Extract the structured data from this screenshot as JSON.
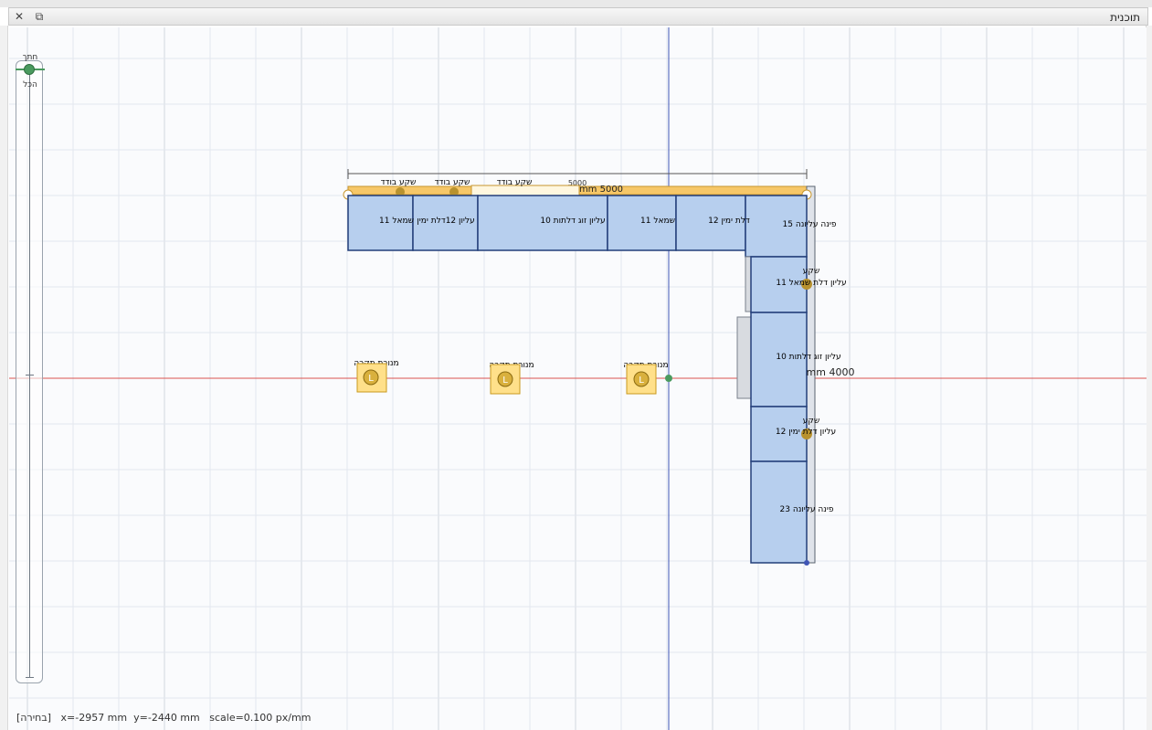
{
  "window": {
    "title": "תוכנית",
    "close_glyph": "✕",
    "restore_glyph": "⧉"
  },
  "zoom": {
    "top_label": "חתך",
    "bottom_label": "הכל"
  },
  "dimensions": {
    "overall_width_small": "5000",
    "overall_width_large": "mm 5000",
    "overall_depth_large": "mm 4000"
  },
  "labels_top": {
    "sink1": "שקע בודד",
    "sink2": "שקע בודד",
    "sink3": "שקע בודד"
  },
  "cabinets_top": [
    {
      "label": "שמאל 11",
      "name": "cabinet-left-11"
    },
    {
      "label": "עליון 12דלת ימין",
      "name": "cabinet-top-12-right"
    },
    {
      "label": "עליון זוג דלתות 10",
      "name": "cabinet-double-10"
    },
    {
      "label": "שמאל 11",
      "name": "cabinet-left-11-b"
    },
    {
      "label": "12 דלת ימין",
      "name": "cabinet-right-12"
    },
    {
      "label": "פינה עליונה 15",
      "name": "cabinet-corner-15"
    }
  ],
  "cabinets_right": [
    {
      "label": "עליון דלת שמאל 11",
      "name": "cabinet-upper-left-11"
    },
    {
      "label": "עליון זוג דלתות 10",
      "name": "cabinet-upper-double-10"
    },
    {
      "label": "עליון דלת ימין 12",
      "name": "cabinet-upper-right-12"
    },
    {
      "label": "פינה עליונה 23",
      "name": "cabinet-corner-23"
    }
  ],
  "right_side_labels": {
    "sink_a": "שקע",
    "sink_b": "שקע"
  },
  "ceiling_lights": [
    {
      "label": "מנורת תקרה",
      "glyph": "L"
    },
    {
      "label": "מנורת תקרה",
      "glyph": "L"
    },
    {
      "label": "מנורת תקרה",
      "glyph": "L"
    }
  ],
  "status": {
    "mode": "[בחירה]",
    "x": "x=-2957 mm",
    "y": "y=-2440 mm",
    "scale": "scale=0.100 px/mm"
  },
  "colors": {
    "cabinet_fill": "#b7cfee",
    "cabinet_stroke": "#233f7a",
    "light_fill": "#ffe08a",
    "light_stroke": "#c89a1e",
    "axis_x": "#d9534f",
    "axis_y": "#3f55b5",
    "wall": "#f6c768"
  }
}
